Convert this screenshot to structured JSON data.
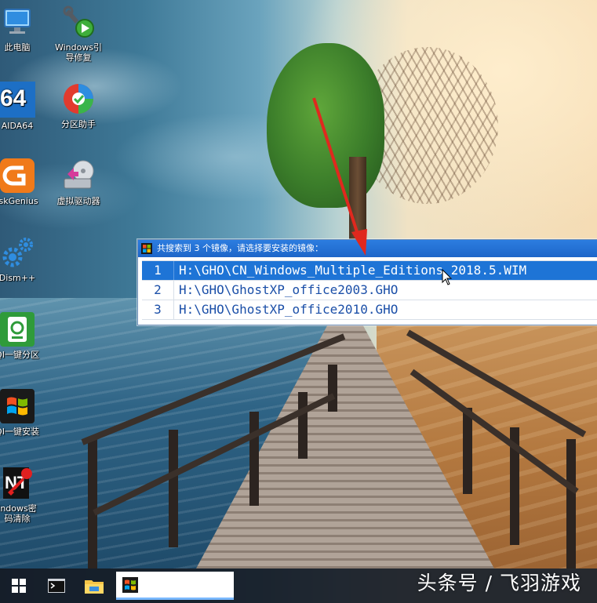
{
  "desktop": {
    "icons": [
      {
        "label": "此电脑",
        "icon": "computer-icon"
      },
      {
        "label": "Windows引导修复",
        "label_line1": "Windows引",
        "label_line2": "导修复",
        "icon": "wrench-repair-icon"
      },
      {
        "label": "AIDA64",
        "badge": "64",
        "icon": "aida64-icon"
      },
      {
        "label": "分区助手",
        "icon": "partition-assistant-icon"
      },
      {
        "label": "iskGenius",
        "icon": "diskgenius-icon"
      },
      {
        "label": "虚拟驱动器",
        "icon": "virtual-drive-icon"
      },
      {
        "label": "Dism++",
        "icon": "gears-icon"
      },
      {
        "label": "QI一键分区",
        "icon": "one-key-partition-icon"
      },
      {
        "label": "QI一键安装",
        "icon": "windows-install-icon"
      },
      {
        "label": "Windows密码清除",
        "label_line1": "indows密",
        "label_line2": "码清除",
        "badge": "NT",
        "icon": "password-key-icon"
      }
    ]
  },
  "dialog": {
    "title": "共搜索到 3 个镜像，请选择要安装的镜像：",
    "items": [
      {
        "num": "1",
        "path": "H:\\GHO\\CN_Windows_Multiple_Editions_2018.5.WIM",
        "selected": true
      },
      {
        "num": "2",
        "path": "H:\\GHO\\GhostXP_office2003.GHO",
        "selected": false
      },
      {
        "num": "3",
        "path": "H:\\GHO\\GhostXP_office2010.GHO",
        "selected": false
      }
    ]
  },
  "taskbar": {
    "buttons": [
      "start-icon",
      "terminal-icon",
      "file-explorer-icon",
      "windows-app-icon"
    ]
  },
  "watermark": "头条号 / 飞羽游戏",
  "colors": {
    "titlebar": "#1d66c9",
    "selected_row": "#1e74d6",
    "list_text": "#1b4fa8",
    "annotation_arrow": "#e0281e"
  }
}
